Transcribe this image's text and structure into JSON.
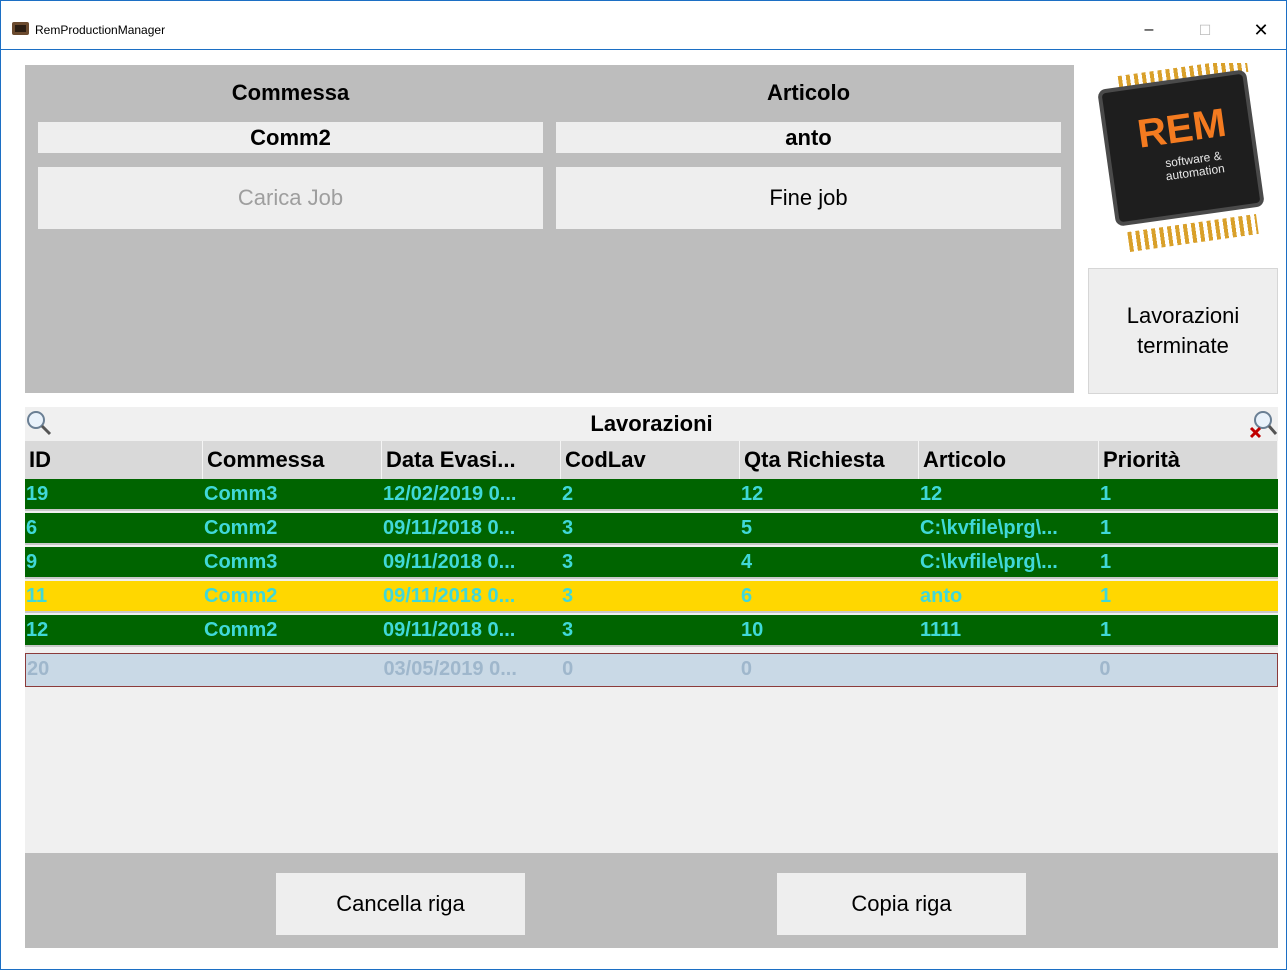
{
  "window": {
    "title": "RemProductionManager",
    "minimize": "–",
    "maximize": "☐",
    "close": "✕"
  },
  "job": {
    "commessa_label": "Commessa",
    "articolo_label": "Articolo",
    "commessa_value": "Comm2",
    "articolo_value": "anto",
    "load_button": "Carica Job",
    "end_button": "Fine job"
  },
  "logo": {
    "brand": "REM",
    "tagline_1": "software &",
    "tagline_2": "automation"
  },
  "side": {
    "finished_button_line1": "Lavorazioni",
    "finished_button_line2": "terminate"
  },
  "grid": {
    "title": "Lavorazioni",
    "columns": [
      "ID",
      "Commessa",
      "Data Evasi...",
      "CodLav",
      "Qta Richiesta",
      "Articolo",
      "Priorità"
    ],
    "rows": [
      {
        "style": "green",
        "cells": [
          "19",
          "Comm3",
          "12/02/2019 0...",
          "2",
          "12",
          "12",
          "1"
        ]
      },
      {
        "style": "green",
        "cells": [
          "6",
          "Comm2",
          "09/11/2018 0...",
          "3",
          "5",
          "C:\\kvfile\\prg\\...",
          "1"
        ]
      },
      {
        "style": "green",
        "cells": [
          "9",
          "Comm3",
          "09/11/2018 0...",
          "3",
          "4",
          "C:\\kvfile\\prg\\...",
          "1"
        ]
      },
      {
        "style": "yellow",
        "cells": [
          "11",
          "Comm2",
          "09/11/2018 0...",
          "3",
          "6",
          "anto",
          "1"
        ]
      },
      {
        "style": "green",
        "cells": [
          "12",
          "Comm2",
          "09/11/2018 0...",
          "3",
          "10",
          "1111",
          "1"
        ]
      },
      {
        "style": "new",
        "cells": [
          "20",
          "",
          "03/05/2019 0...",
          "0",
          "0",
          "",
          "0"
        ]
      }
    ]
  },
  "bottom": {
    "delete_button": "Cancella riga",
    "copy_button": "Copia riga"
  },
  "colors": {
    "row_green": "#006400",
    "row_yellow": "#ffd700",
    "row_text": "#40d8d8",
    "panel_gray": "#bdbdbd",
    "logo_orange": "#f47b20"
  }
}
